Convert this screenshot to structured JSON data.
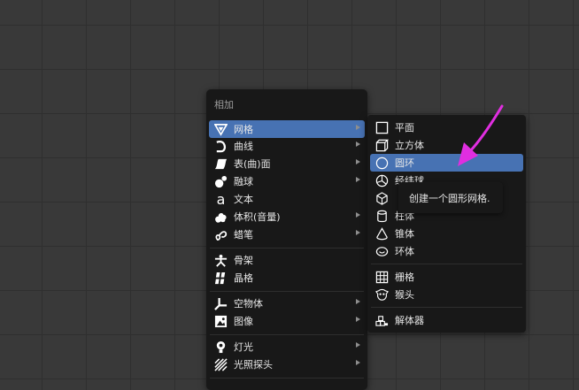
{
  "add_menu": {
    "title": "相加",
    "items": [
      {
        "label": "网格",
        "icon": "mesh-icon"
      },
      {
        "label": "曲线",
        "icon": "curve-icon"
      },
      {
        "label": "表(曲)面",
        "icon": "surface-icon"
      },
      {
        "label": "融球",
        "icon": "metaball-icon"
      },
      {
        "label": "文本",
        "icon": "text-icon"
      },
      {
        "label": "体积(音量)",
        "icon": "volume-icon"
      },
      {
        "label": "蜡笔",
        "icon": "grease-pencil-icon"
      },
      {
        "label": "骨架",
        "icon": "armature-icon"
      },
      {
        "label": "晶格",
        "icon": "lattice-icon"
      },
      {
        "label": "空物体",
        "icon": "empty-icon"
      },
      {
        "label": "图像",
        "icon": "image-icon"
      },
      {
        "label": "灯光",
        "icon": "light-icon"
      },
      {
        "label": "光照探头",
        "icon": "light-probe-icon"
      }
    ]
  },
  "mesh_menu": {
    "items": [
      {
        "label": "平面",
        "icon": "plane-icon"
      },
      {
        "label": "立方体",
        "icon": "cube-icon"
      },
      {
        "label": "圆环",
        "icon": "circle-icon"
      },
      {
        "label": "经纬球",
        "icon": "uv-sphere-icon"
      },
      {
        "label": "柱体",
        "icon": "cylinder-icon"
      },
      {
        "label": "锥体",
        "icon": "cone-icon"
      },
      {
        "label": "环体",
        "icon": "torus-icon"
      },
      {
        "label": "栅格",
        "icon": "grid-icon"
      },
      {
        "label": "猴头",
        "icon": "monkey-icon"
      },
      {
        "label": "解体器",
        "icon": "dissolver-icon"
      }
    ]
  },
  "tooltip": {
    "text": "创建一个圆形网格."
  },
  "colors": {
    "highlight": "#4772b3",
    "menu_bg": "#181818",
    "annotation_arrow": "#e02ee0"
  }
}
